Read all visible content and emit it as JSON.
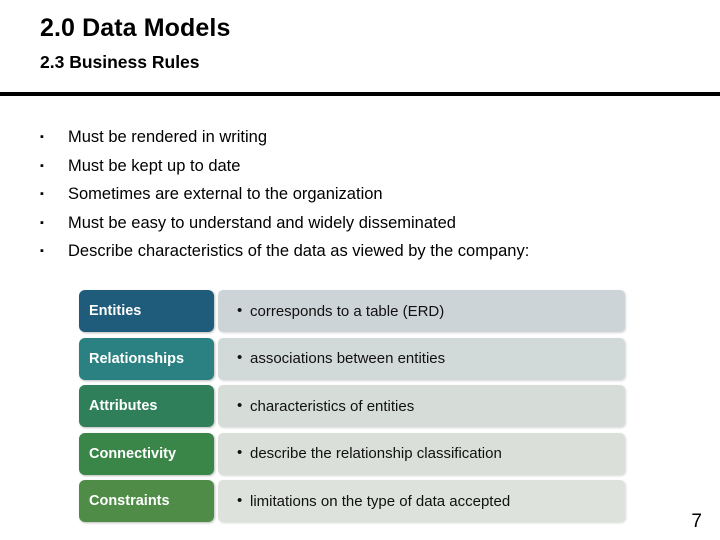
{
  "header": {
    "title": "2.0 Data Models",
    "subtitle": "2.3 Business Rules"
  },
  "bullets": {
    "marker": "▪",
    "items": [
      "Must be rendered in writing",
      "Must be kept up to date",
      "Sometimes are external to the organization",
      "Must be easy to understand and widely disseminated",
      "Describe characteristics of the data as viewed by the company:"
    ]
  },
  "definitions": {
    "marker": "•",
    "rows": [
      {
        "term": "Entities",
        "description": "corresponds to a table (ERD)",
        "label_color": "#1F5B7A",
        "panel_color": "#CDD4D8"
      },
      {
        "term": "Relationships",
        "description": "associations between entities",
        "label_color": "#2B8181",
        "panel_color": "#D2DAD9"
      },
      {
        "term": "Attributes",
        "description": "characteristics of entities",
        "label_color": "#2F7F5B",
        "panel_color": "#D6DDD8"
      },
      {
        "term": "Connectivity",
        "description": "describe the relationship classification",
        "label_color": "#3A8548",
        "panel_color": "#DAE0D9"
      },
      {
        "term": "Constraints",
        "description": "limitations on the type of data accepted",
        "label_color": "#4E8C47",
        "panel_color": "#DDE3DC"
      }
    ]
  },
  "footer": {
    "page_number": "7"
  }
}
